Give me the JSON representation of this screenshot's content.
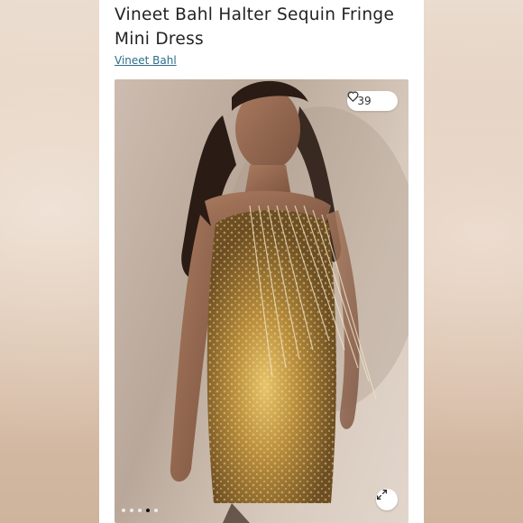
{
  "product": {
    "title": "Vineet Bahl Halter Sequin Fringe Mini Dress",
    "brand": "Vineet Bahl"
  },
  "gallery": {
    "like_count": "39",
    "like_icon": "heart-outline-icon",
    "expand_icon": "expand-arrows-icon",
    "image_count": 5,
    "active_index": 3
  },
  "colors": {
    "brand_link": "#2b6f8a",
    "dress_gold": "#c9a24a"
  }
}
